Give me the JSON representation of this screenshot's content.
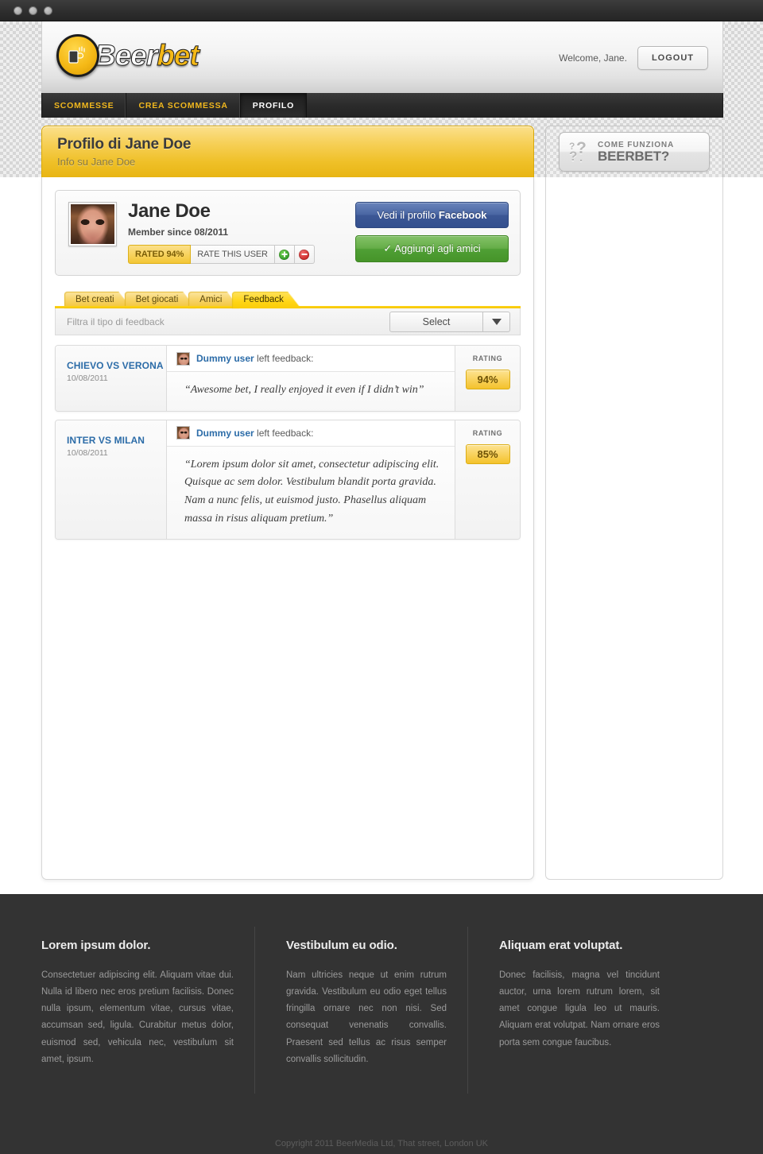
{
  "window": {
    "dots": [
      "close",
      "minimize",
      "zoom"
    ]
  },
  "header": {
    "logo_primary": "Beer",
    "logo_secondary": "bet",
    "welcome": "Welcome, Jane.",
    "logout_label": "LOGOUT"
  },
  "nav": {
    "items": [
      {
        "label": "SCOMMESSE",
        "active": false
      },
      {
        "label": "CREA SCOMMESSA",
        "active": false
      },
      {
        "label": "PROFILO",
        "active": true
      }
    ]
  },
  "page_head": {
    "title": "Profilo di Jane Doe",
    "subtitle": "Info su Jane Doe"
  },
  "aside": {
    "how_it_works_line1": "COME FUNZIONA",
    "how_it_works_line2": "BEERBET?"
  },
  "profile": {
    "name": "Jane Doe",
    "member_since": "Member since 08/2011",
    "rated_chip": "RATED 94%",
    "rate_chip": "RATE THIS USER",
    "facebook_button_prefix": "Vedi il profilo ",
    "facebook_button_bold": "Facebook",
    "friend_button": "✓ Aggiungi agli amici"
  },
  "tabs": [
    {
      "label": "Bet creati",
      "active": false
    },
    {
      "label": "Bet giocati",
      "active": false
    },
    {
      "label": "Amici",
      "active": false
    },
    {
      "label": "Feedback",
      "active": true
    }
  ],
  "filter": {
    "label": "Filtra il tipo di feedback",
    "select_value": "Select"
  },
  "feedback": {
    "rating_column_label": "RATING",
    "left_feedback_suffix": " left feedback:",
    "items": [
      {
        "match": "CHIEVO VS VERONA",
        "date": "10/08/2011",
        "user": "Dummy user",
        "quote": "“Awesome bet, I really enjoyed it even if I didn’t win”",
        "rating": "94%"
      },
      {
        "match": "INTER VS MILAN",
        "date": "10/08/2011",
        "user": "Dummy user",
        "quote": "“Lorem ipsum dolor sit amet, consectetur adipiscing elit. Quisque ac sem dolor. Vestibulum blandit porta gravida. Nam a nunc felis, ut euismod justo. Phasellus aliquam massa in risus aliquam pretium.”",
        "rating": "85%"
      }
    ]
  },
  "footer": {
    "columns": [
      {
        "title": "Lorem ipsum dolor.",
        "text": "Consectetuer adipiscing elit. Aliquam vitae dui. Nulla id libero nec eros pretium facilisis. Donec nulla ipsum, elementum vitae, cursus vitae, accumsan sed, ligula. Curabitur metus dolor, euismod sed, vehicula nec, vestibulum sit amet, ipsum."
      },
      {
        "title": "Vestibulum eu odio.",
        "text": "Nam ultricies neque ut enim rutrum gravida. Vestibulum eu odio eget tellus fringilla ornare nec non nisi. Sed consequat venenatis convallis. Praesent sed tellus ac risus semper convallis sollicitudin."
      },
      {
        "title": "Aliquam erat voluptat.",
        "text": "Donec facilisis, magna vel tincidunt auctor, urna lorem rutrum lorem, sit amet congue ligula leo ut mauris. Aliquam erat volutpat. Nam ornare eros porta sem congue faucibus."
      }
    ],
    "copyright": "Copyright 2011 BeerMedia Ltd, That street, London UK"
  },
  "colors": {
    "brand_yellow": "#f5b916",
    "nav_dark": "#2b2b2b",
    "facebook_blue": "#4a66a3",
    "friend_green": "#65ad48",
    "link_blue": "#2c6ca8",
    "footer_bg": "#333333"
  }
}
